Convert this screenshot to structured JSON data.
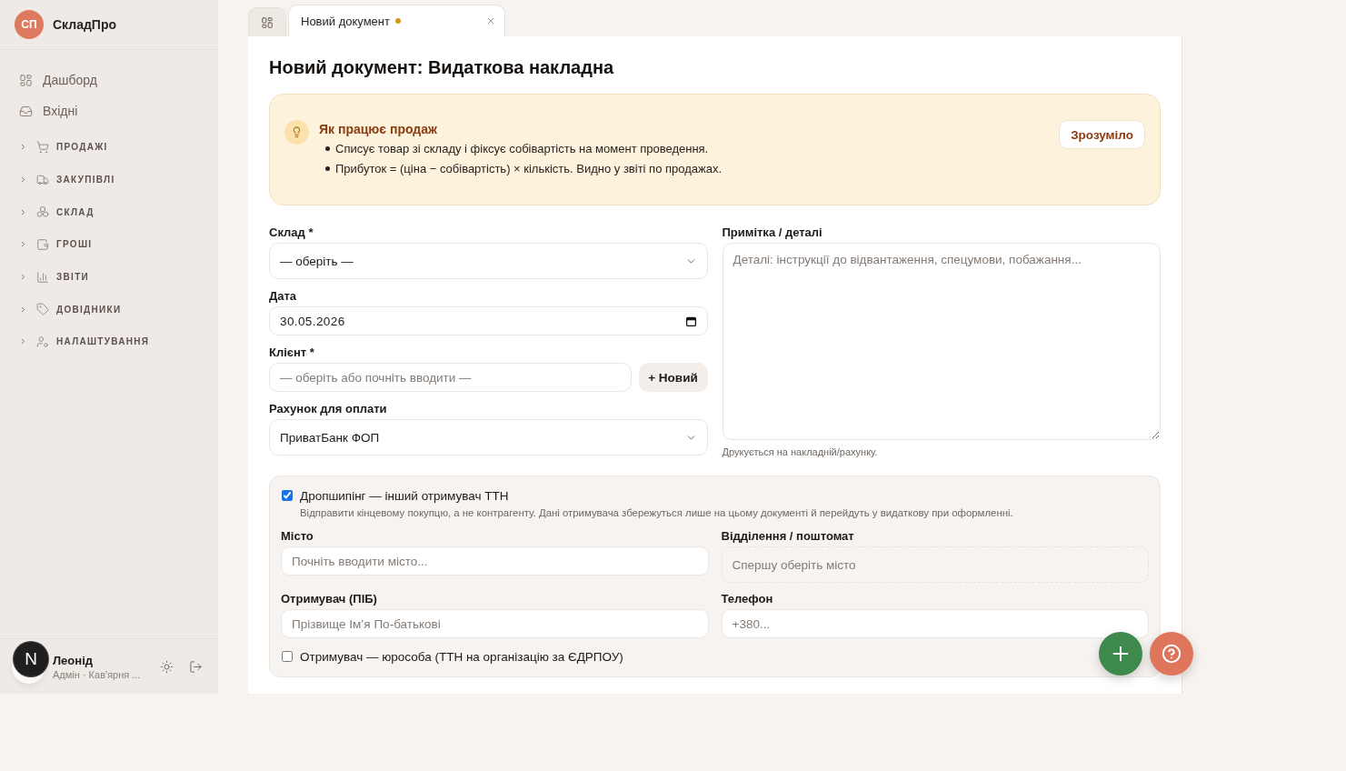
{
  "sidebar": {
    "brand": {
      "initials": "СП",
      "name": "СкладПро"
    },
    "links": [
      {
        "label": "Дашборд",
        "selected": false
      },
      {
        "label": "Вхідні",
        "selected": false
      }
    ],
    "sections": [
      {
        "label": "ПРОДАЖІ",
        "expanded": false
      },
      {
        "label": "ЗАКУПІВЛІ",
        "expanded": false
      },
      {
        "label": "СКЛАД",
        "expanded": false
      },
      {
        "label": "ГРОШІ",
        "expanded": false
      },
      {
        "label": "ЗВІТИ",
        "expanded": false
      },
      {
        "label": "ДОВІДНИКИ",
        "expanded": false
      },
      {
        "label": "НАЛАШТУВАННЯ",
        "expanded": false
      }
    ],
    "user": {
      "name": "Леонід",
      "role": "Адмін · Кав'ярня ..."
    }
  },
  "dev_indicator": {
    "label": "N"
  },
  "tabs": [
    {
      "kind": "home",
      "selected": false
    },
    {
      "kind": "document",
      "label": "Новий документ",
      "unsaved": true,
      "selected": true
    }
  ],
  "document": {
    "title": "Новий документ: Видаткова накладна",
    "hint": {
      "title": "Як працює продаж",
      "bullets": [
        "Списує товар зі складу і фіксує собівартість на момент проведення.",
        "Прибуток = (ціна − собівартість) × кількість. Видно у звіті по продажах."
      ],
      "dismiss": "Зрозуміло"
    },
    "fields": [
      {
        "kind": "select",
        "label": "Склад *",
        "value": "— оберіть —"
      },
      {
        "kind": "date",
        "label": "Дата",
        "value": "30.05.2026"
      },
      {
        "kind": "text",
        "label": "Клієнт *",
        "placeholder": "— оберіть або почніть вводити —",
        "action": "+ Новий"
      },
      {
        "kind": "select",
        "label": "Рахунок для оплати",
        "value": "ПриватБанк ФОП"
      }
    ],
    "notes": {
      "label": "Примітка / деталі",
      "placeholder": "Деталі: інструкції до відвантаження, спецумови, побажання...",
      "help": "Друкується на накладній/рахунку."
    },
    "dropship": {
      "checked": true,
      "label": "Дропшипінг — інший отримувач ТТН",
      "description": "Відправити кінцевому покупцю, а не контрагенту. Дані отримувача збережуться лише на цьому документі й перейдуть у видаткову при оформленні.",
      "fields": [
        {
          "kind": "text",
          "label": "Місто",
          "placeholder": "Почніть вводити місто...",
          "disabled": false
        },
        {
          "kind": "select",
          "label": "Відділення / поштомат",
          "placeholder": "Спершу оберіть місто",
          "disabled": true
        },
        {
          "kind": "text",
          "label": "Отримувач (ПІБ)",
          "placeholder": "Прізвище Імʼя По-батькові",
          "disabled": false
        },
        {
          "kind": "text",
          "label": "Телефон",
          "placeholder": "+380...",
          "disabled": false
        }
      ],
      "legal_entity": {
        "checked": false,
        "label": "Отримувач — юрособа (ТТН на організацію за ЄДРПОУ)"
      }
    }
  },
  "floating_buttons": [
    {
      "kind": "add"
    },
    {
      "kind": "help"
    }
  ]
}
